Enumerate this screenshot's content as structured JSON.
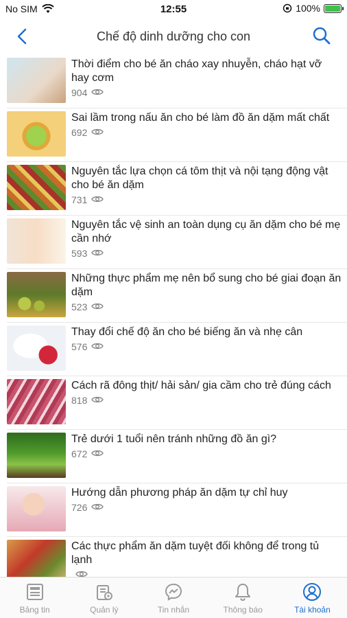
{
  "status_bar": {
    "carrier": "No SIM",
    "time": "12:55",
    "battery_percent": "100%",
    "battery_level": 1.0
  },
  "nav": {
    "back_icon": "chevron-left-icon",
    "title": "Chế độ dinh dưỡng cho con",
    "search_icon": "search-icon"
  },
  "articles": [
    {
      "title": "Thời điểm cho bé ăn cháo xay nhuyễn, cháo hạt vỡ hay cơm",
      "views": "904"
    },
    {
      "title": "Sai lầm trong nấu ăn cho bé làm đồ ăn dặm mất chất",
      "views": "692"
    },
    {
      "title": "Nguyên tắc lựa chọn cá tôm thịt và nội tạng động vật cho bé ăn dặm",
      "views": "731"
    },
    {
      "title": "Nguyên tắc vệ sinh an toàn dụng cụ ăn dặm cho bé mẹ cần nhớ",
      "views": "593"
    },
    {
      "title": "Những thực phẩm mẹ nên bổ sung cho bé giai đoạn ăn dặm",
      "views": "523"
    },
    {
      "title": "Thay đổi chế độ ăn cho bé biếng ăn và nhẹ cân",
      "views": "576"
    },
    {
      "title": "Cách rã đông thịt/ hải sản/ gia cầm cho trẻ đúng cách",
      "views": "818"
    },
    {
      "title": "Trẻ dưới 1 tuổi nên tránh những đồ ăn gì?",
      "views": "672"
    },
    {
      "title": "Hướng dẫn phương pháp ăn dặm tự chỉ huy",
      "views": "726"
    },
    {
      "title": "Các thực phẩm ăn dặm tuyệt đối không để trong tủ lạnh",
      "views": ""
    }
  ],
  "tabs": [
    {
      "label": "Bảng tin",
      "icon": "news-feed-icon",
      "active": false
    },
    {
      "label": "Quản lý",
      "icon": "manage-icon",
      "active": false
    },
    {
      "label": "Tin nhắn",
      "icon": "messenger-icon",
      "active": false
    },
    {
      "label": "Thông báo",
      "icon": "bell-icon",
      "active": false
    },
    {
      "label": "Tài khoản",
      "icon": "account-icon",
      "active": true
    }
  ],
  "colors": {
    "accent": "#1e6fcf",
    "inactive_tab": "#9a9a9a",
    "battery": "#3fc24a"
  }
}
